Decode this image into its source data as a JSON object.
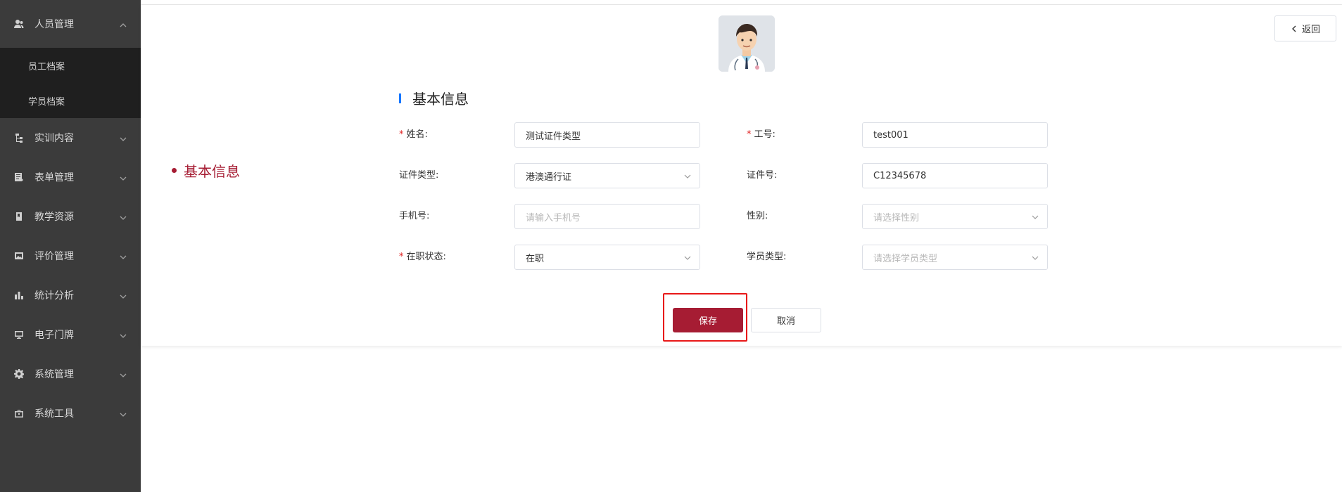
{
  "sidebar": {
    "items": [
      {
        "label": "人员管理",
        "icon": "users-icon",
        "expanded": true,
        "children": [
          {
            "label": "员工档案"
          },
          {
            "label": "学员档案"
          }
        ]
      },
      {
        "label": "实训内容",
        "icon": "tree-icon"
      },
      {
        "label": "表单管理",
        "icon": "form-icon"
      },
      {
        "label": "教学资源",
        "icon": "book-icon"
      },
      {
        "label": "评价管理",
        "icon": "image-icon"
      },
      {
        "label": "统计分析",
        "icon": "bar-chart-icon"
      },
      {
        "label": "电子门牌",
        "icon": "monitor-icon"
      },
      {
        "label": "系统管理",
        "icon": "gear-icon"
      },
      {
        "label": "系统工具",
        "icon": "toolbox-icon"
      }
    ]
  },
  "header": {
    "back_label": "返回"
  },
  "anchor": {
    "label": "基本信息"
  },
  "section": {
    "title": "基本信息"
  },
  "form": {
    "name": {
      "label": "姓名:",
      "required": true,
      "value": "测试证件类型"
    },
    "employee_no": {
      "label": "工号:",
      "required": true,
      "value": "test001"
    },
    "id_type": {
      "label": "证件类型:",
      "value": "港澳通行证"
    },
    "id_no": {
      "label": "证件号:",
      "value": "C12345678"
    },
    "phone": {
      "label": "手机号:",
      "placeholder": "请输入手机号"
    },
    "gender": {
      "label": "性别:",
      "placeholder": "请选择性别"
    },
    "status": {
      "label": "在职状态:",
      "required": true,
      "value": "在职"
    },
    "student_type": {
      "label": "学员类型:",
      "placeholder": "请选择学员类型"
    }
  },
  "actions": {
    "save_label": "保存",
    "cancel_label": "取消"
  },
  "colors": {
    "brand": "#a61c33",
    "sidebar_bg": "#3b3b3b",
    "submenu_bg": "#1f1f1f",
    "accent_bar": "#1677ff",
    "highlight": "#e81818"
  }
}
